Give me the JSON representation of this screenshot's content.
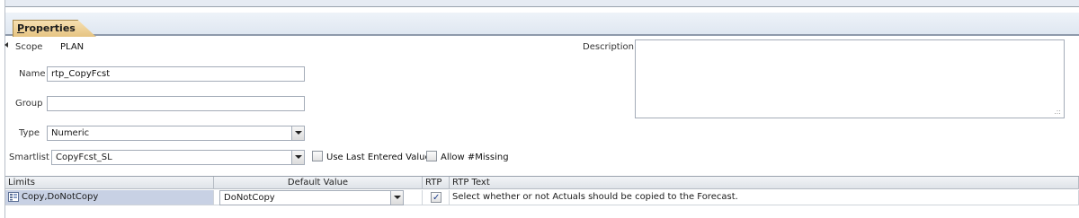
{
  "tab": {
    "label": "Properties",
    "accelerator": "P"
  },
  "scope": {
    "label": "Scope",
    "value": "PLAN"
  },
  "description": {
    "label": "Description",
    "value": ""
  },
  "name": {
    "label": "Name",
    "value": "rtp_CopyFcst"
  },
  "group": {
    "label": "Group",
    "value": ""
  },
  "type": {
    "label": "Type",
    "value": "Numeric"
  },
  "smartlist": {
    "label": "Smartlist",
    "value": "CopyFcst_SL"
  },
  "options": {
    "use_last_entered": {
      "label": "Use Last Entered Value",
      "checked": false
    },
    "allow_missing": {
      "label": "Allow #Missing",
      "checked": false
    }
  },
  "grid": {
    "headers": {
      "limits": "Limits",
      "default_value": "Default Value",
      "rtp": "RTP",
      "rtp_text": "RTP Text"
    },
    "rows": [
      {
        "limits": "Copy,DoNotCopy",
        "default_value": "DoNotCopy",
        "rtp": true,
        "rtp_text": "Select whether or not Actuals should be copied to the Forecast."
      }
    ]
  },
  "colors": {
    "tab_bg": "#e6c482",
    "selected_row": "#c8d1e4",
    "border": "#a4acb8"
  }
}
